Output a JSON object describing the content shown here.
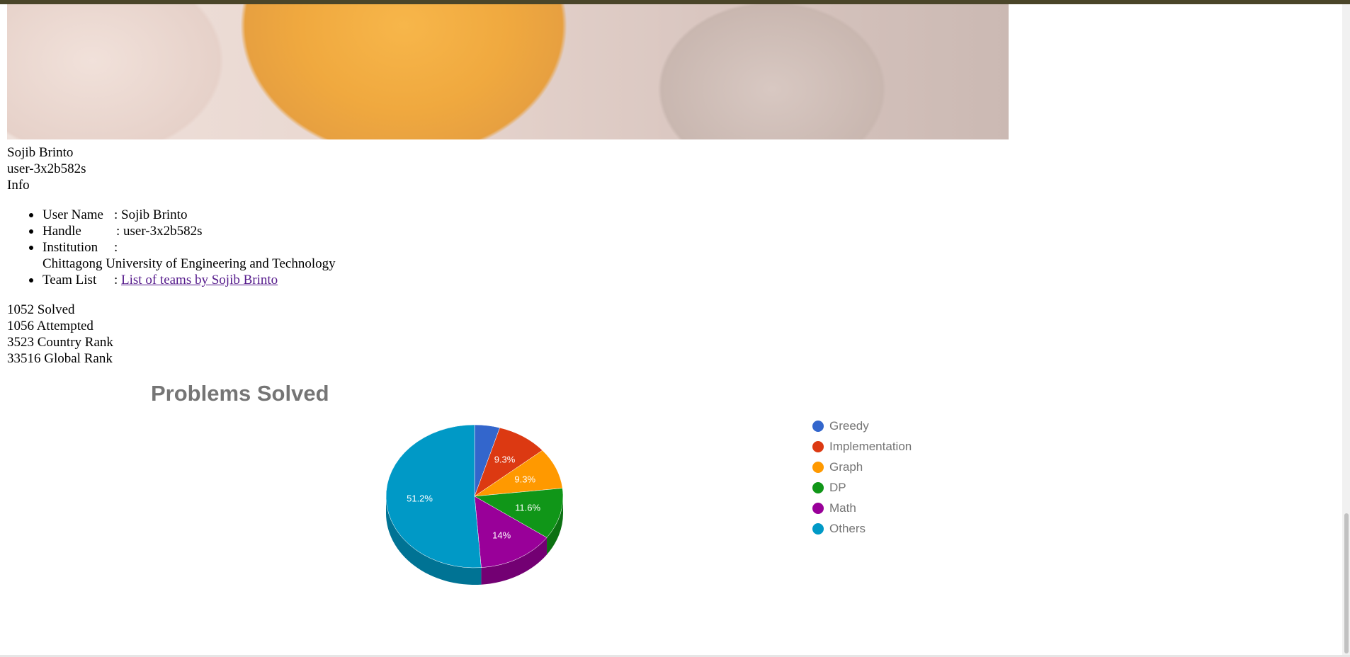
{
  "profile": {
    "name": "Sojib Brinto",
    "handle": "user-3x2b582s",
    "info_heading": "Info"
  },
  "info": {
    "items": [
      {
        "label": "User Name",
        "value": "Sojib Brinto"
      },
      {
        "label": "Handle",
        "value": "user-3x2b582s"
      },
      {
        "label": "Institution",
        "value": "Chittagong University of Engineering and Technology"
      },
      {
        "label": "Team List",
        "value": " List of teams by Sojib Brinto"
      }
    ],
    "separator": ":"
  },
  "stats": [
    "1052 Solved",
    "1056 Attempted",
    "3523 Country Rank",
    "33516 Global Rank"
  ],
  "chart_data": {
    "type": "pie",
    "title": "Problems Solved",
    "categories": [
      "Greedy",
      "Implementation",
      "Graph",
      "DP",
      "Math",
      "Others"
    ],
    "values": [
      4.6,
      9.3,
      9.3,
      11.6,
      14,
      51.2
    ],
    "data_labels": [
      "",
      "9.3%",
      "9.3%",
      "11.6%",
      "14%",
      "51.2%"
    ],
    "colors": [
      "#3366cc",
      "#dc3912",
      "#ff9900",
      "#109618",
      "#990099",
      "#0099c6"
    ],
    "side_colors": [
      "#264d99",
      "#a52b0e",
      "#bf7300",
      "#0c7112",
      "#730073",
      "#007394"
    ],
    "legend_position": "right"
  }
}
